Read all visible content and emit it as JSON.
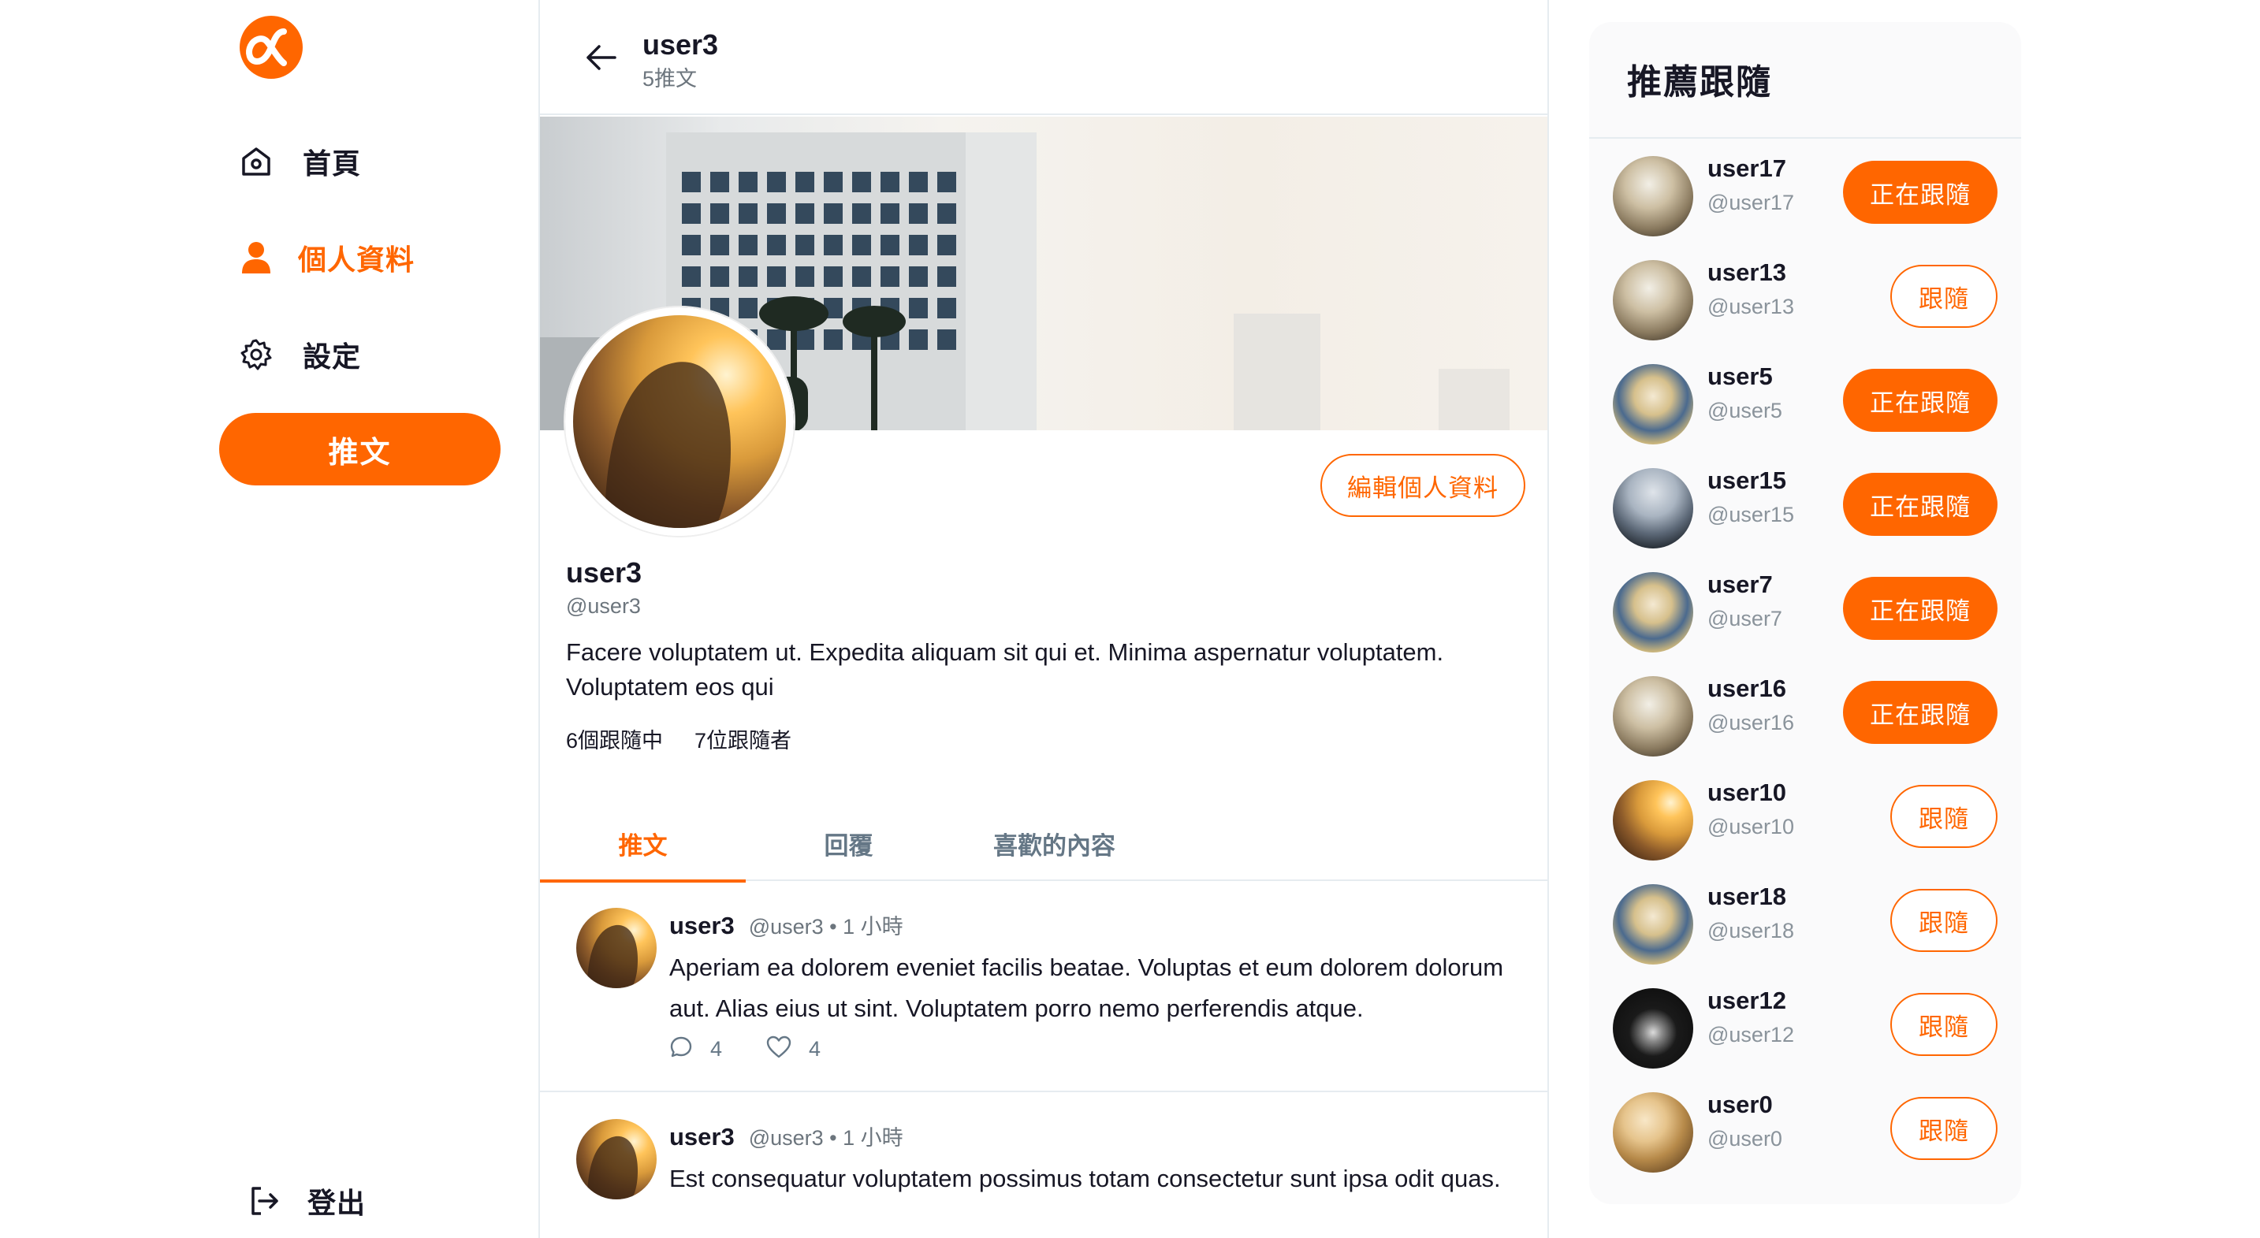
{
  "colors": {
    "accent": "#ff6600",
    "text": "#171725",
    "muted": "#6c757d",
    "border": "#e6ecf0"
  },
  "sidebar": {
    "logo_icon": "alpha-logo-icon",
    "items": [
      {
        "label": "首頁",
        "icon": "home-icon",
        "active": false
      },
      {
        "label": "個人資料",
        "icon": "user-icon",
        "active": true
      },
      {
        "label": "設定",
        "icon": "gear-icon",
        "active": false
      }
    ],
    "tweet_button": "推文",
    "logout": {
      "label": "登出",
      "icon": "logout-icon"
    }
  },
  "header": {
    "name": "user3",
    "tweet_count": "5推文",
    "back_icon": "arrow-left-icon"
  },
  "profile": {
    "edit_button": "編輯個人資料",
    "name": "user3",
    "handle": "@user3",
    "bio": "Facere voluptatem ut. Expedita aliquam sit qui et. Minima aspernatur voluptatem. Voluptatem eos qui",
    "following": "6個跟隨中",
    "followers": "7位跟隨者"
  },
  "tabs": [
    {
      "label": "推文",
      "active": true
    },
    {
      "label": "回覆",
      "active": false
    },
    {
      "label": "喜歡的內容",
      "active": false
    }
  ],
  "tweets": [
    {
      "name": "user3",
      "meta": "@user3 • 1 小時",
      "text": "Aperiam ea dolorem eveniet facilis beatae. Voluptas et eum dolorem dolorum aut. Alias eius ut sint. Voluptatem porro nemo perferendis atque.",
      "replies": "4",
      "likes": "4"
    },
    {
      "name": "user3",
      "meta": "@user3 • 1 小時",
      "text": "Est consequatur voluptatem possimus totam consectetur sunt ipsa odit quas."
    }
  ],
  "suggestions": {
    "title": "推薦跟隨",
    "users": [
      {
        "name": "user17",
        "handle": "@user17",
        "button": "正在跟隨",
        "following": true,
        "avatar": "desert"
      },
      {
        "name": "user13",
        "handle": "@user13",
        "button": "跟隨",
        "following": false,
        "avatar": "desert"
      },
      {
        "name": "user5",
        "handle": "@user5",
        "button": "正在跟隨",
        "following": true,
        "avatar": "sunglass"
      },
      {
        "name": "user15",
        "handle": "@user15",
        "button": "正在跟隨",
        "following": true,
        "avatar": "sea"
      },
      {
        "name": "user7",
        "handle": "@user7",
        "button": "正在跟隨",
        "following": true,
        "avatar": "sunglass"
      },
      {
        "name": "user16",
        "handle": "@user16",
        "button": "正在跟隨",
        "following": true,
        "avatar": "desert"
      },
      {
        "name": "user10",
        "handle": "@user10",
        "button": "跟隨",
        "following": false,
        "avatar": "field"
      },
      {
        "name": "user18",
        "handle": "@user18",
        "button": "跟隨",
        "following": false,
        "avatar": "sunglass"
      },
      {
        "name": "user12",
        "handle": "@user12",
        "button": "跟隨",
        "following": false,
        "avatar": "dark"
      },
      {
        "name": "user0",
        "handle": "@user0",
        "button": "跟隨",
        "following": false,
        "avatar": "bench"
      }
    ]
  }
}
